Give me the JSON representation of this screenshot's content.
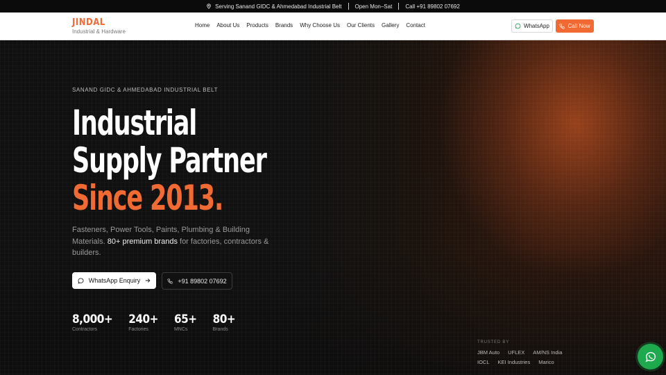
{
  "topbar": {
    "location": "Serving Sanand GIDC & Ahmedabad Industrial Belt",
    "hours": "Open Mon–Sat",
    "phone": "Call +91 89802 07692"
  },
  "nav": {
    "logo_title": "JINDAL",
    "logo_subtitle": "Industrial & Hardware",
    "menu": [
      "Home",
      "About Us",
      "Products",
      "Brands",
      "Why Choose Us",
      "Our Clients",
      "Gallery",
      "Contact"
    ],
    "whatsapp_label": "WhatsApp",
    "call_label": "Call Now"
  },
  "hero": {
    "eyebrow": "SANAND GIDC & AHMEDABAD INDUSTRIAL BELT",
    "headline_line1": "Industrial",
    "headline_line2": "Supply Partner",
    "headline_accent": "Since 2013.",
    "desc_part1": "Fasteners, Power Tools, Paints, Plumbing & Building Materials. ",
    "desc_strong": "80+ premium brands",
    "desc_part2": " for factories, contractors & builders.",
    "cta_whatsapp": "WhatsApp Enquiry",
    "cta_phone": "+91 89802 07692",
    "stats": [
      {
        "value": "8,000+",
        "label": "Contractors"
      },
      {
        "value": "240+",
        "label": "Factories"
      },
      {
        "value": "65+",
        "label": "MNCs"
      },
      {
        "value": "80+",
        "label": "Brands"
      }
    ],
    "trusted_title": "TRUSTED BY",
    "trusted_brands": [
      "JBM Auto",
      "UFLEX",
      "AM/NS India",
      "IOCL",
      "KEI Industries",
      "Marico"
    ]
  },
  "colors": {
    "accent": "#f26a33",
    "whatsapp_green": "#1fa94f",
    "hero_bg": "#0d0d0d"
  },
  "icons": [
    "location-pin-icon",
    "whatsapp-icon",
    "phone-icon",
    "chat-bubble-icon",
    "arrow-right-icon"
  ]
}
